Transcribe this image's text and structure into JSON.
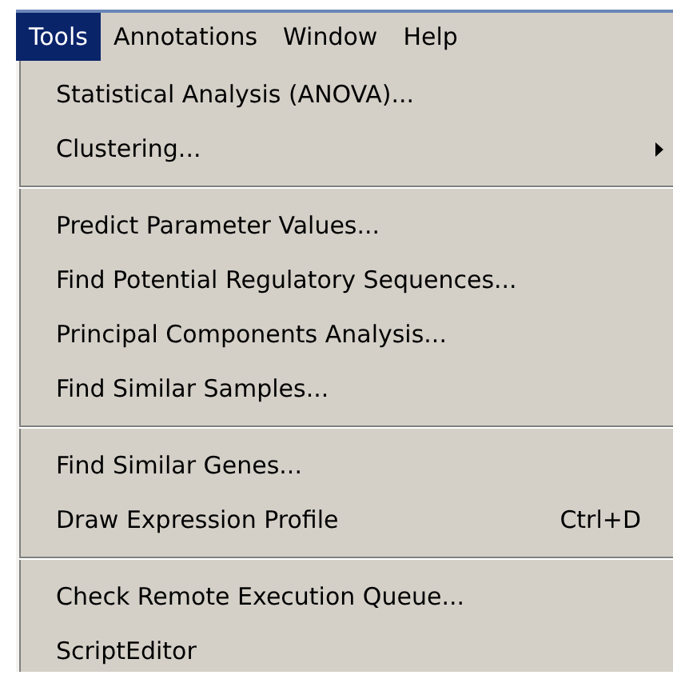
{
  "menubar": [
    {
      "label": "Tools",
      "selected": true
    },
    {
      "label": "Annotations",
      "selected": false
    },
    {
      "label": "Window",
      "selected": false
    },
    {
      "label": "Help",
      "selected": false
    }
  ],
  "menu": {
    "items": [
      {
        "kind": "item",
        "label": "Statistical Analysis (ANOVA)..."
      },
      {
        "kind": "item",
        "label": "Clustering...",
        "submenu": true
      },
      {
        "kind": "separator"
      },
      {
        "kind": "item",
        "label": "Predict Parameter Values..."
      },
      {
        "kind": "item",
        "label": "Find Potential Regulatory Sequences..."
      },
      {
        "kind": "item",
        "label": "Principal Components Analysis..."
      },
      {
        "kind": "item",
        "label": "Find Similar Samples..."
      },
      {
        "kind": "separator"
      },
      {
        "kind": "item",
        "label": "Find Similar Genes..."
      },
      {
        "kind": "item",
        "label": "Draw Expression Profile",
        "shortcut": "Ctrl+D"
      },
      {
        "kind": "separator"
      },
      {
        "kind": "item",
        "label": "Check Remote Execution Queue..."
      },
      {
        "kind": "item",
        "label": "ScriptEditor"
      }
    ]
  }
}
